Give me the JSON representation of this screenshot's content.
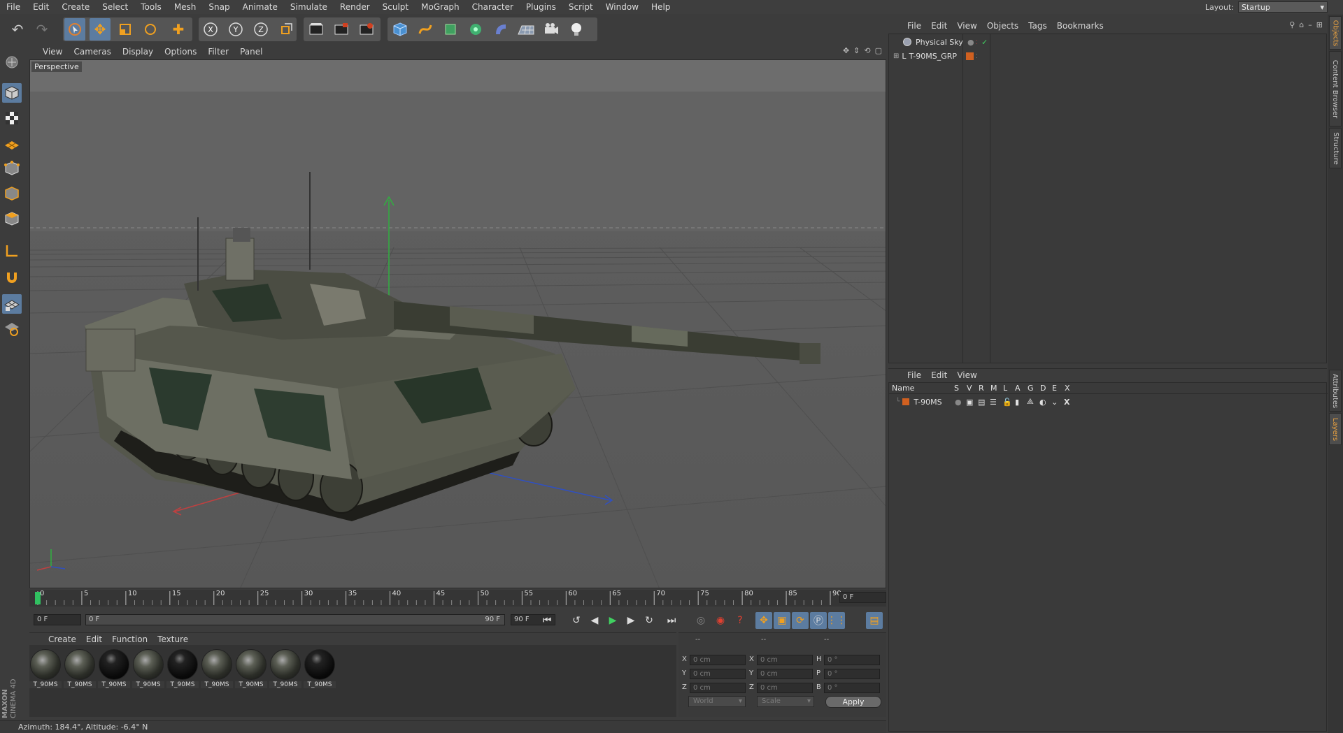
{
  "menubar": {
    "items": [
      "File",
      "Edit",
      "Create",
      "Select",
      "Tools",
      "Mesh",
      "Snap",
      "Animate",
      "Simulate",
      "Render",
      "Sculpt",
      "MoGraph",
      "Character",
      "Plugins",
      "Script",
      "Window",
      "Help"
    ],
    "layout_label": "Layout:",
    "layout_value": "Startup"
  },
  "toolbar": {
    "icons": [
      "undo-icon",
      "redo-icon",
      "live-selection-icon",
      "move-icon",
      "scale-icon",
      "rotate-icon",
      "recent-tool-icon",
      "x-axis-lock-icon",
      "y-axis-lock-icon",
      "z-axis-lock-icon",
      "coordinate-system-icon",
      "render-view-icon",
      "render-picture-viewer-icon",
      "render-settings-icon",
      "cube-primitive-icon",
      "spline-icon",
      "nurbs-icon",
      "array-icon",
      "deformer-icon",
      "floor-icon",
      "camera-icon",
      "light-icon"
    ],
    "axis_labels": [
      "X",
      "Y",
      "Z"
    ]
  },
  "viewport": {
    "menu": [
      "View",
      "Cameras",
      "Display",
      "Options",
      "Filter",
      "Panel"
    ],
    "label": "Perspective"
  },
  "timeline": {
    "ticks": [
      "0",
      "5",
      "10",
      "15",
      "20",
      "25",
      "30",
      "35",
      "40",
      "45",
      "50",
      "55",
      "60",
      "65",
      "70",
      "75",
      "80",
      "85",
      "90"
    ],
    "current_frame": "0 F",
    "start_frame": "0 F",
    "range_start": "0 F",
    "range_end": "90 F",
    "end_frame": "90 F"
  },
  "materials": {
    "menu": [
      "Create",
      "Edit",
      "Function",
      "Texture"
    ],
    "items": [
      {
        "name": "T_90MS",
        "dark": false
      },
      {
        "name": "T_90MS",
        "dark": false
      },
      {
        "name": "T_90MS",
        "dark": true
      },
      {
        "name": "T_90MS",
        "dark": false
      },
      {
        "name": "T_90MS",
        "dark": true
      },
      {
        "name": "T_90MS",
        "dark": false
      },
      {
        "name": "T_90MS",
        "dark": false
      },
      {
        "name": "T_90MS",
        "dark": false
      },
      {
        "name": "T_90MS",
        "dark": true
      }
    ]
  },
  "coordinates": {
    "headers": [
      "--",
      "--",
      "--"
    ],
    "rows": [
      {
        "a": "X",
        "av": "0 cm",
        "b": "X",
        "bv": "0 cm",
        "c": "H",
        "cv": "0 °"
      },
      {
        "a": "Y",
        "av": "0 cm",
        "b": "Y",
        "bv": "0 cm",
        "c": "P",
        "cv": "0 °"
      },
      {
        "a": "Z",
        "av": "0 cm",
        "b": "Z",
        "bv": "0 cm",
        "c": "B",
        "cv": "0 °"
      }
    ],
    "mode_world": "World",
    "mode_scale": "Scale",
    "apply_label": "Apply"
  },
  "status": {
    "text": "Azimuth: 184.4°, Altitude: -6.4°  N"
  },
  "object_manager": {
    "menu": [
      "File",
      "Edit",
      "View",
      "Objects",
      "Tags",
      "Bookmarks"
    ],
    "objects": [
      {
        "name": "Physical Sky",
        "color": "#9aa0b0"
      },
      {
        "name": "T-90MS_GRP",
        "color": "#d06020"
      }
    ]
  },
  "layer_manager": {
    "menu": [
      "File",
      "Edit",
      "View"
    ],
    "columns": [
      "Name",
      "S",
      "V",
      "R",
      "M",
      "L",
      "A",
      "G",
      "D",
      "E",
      "X"
    ],
    "layers": [
      {
        "name": "T-90MS",
        "color": "#d06020"
      }
    ]
  },
  "right_tabs": [
    "Objects",
    "Content Browser",
    "Structure",
    "Attributes",
    "Layers"
  ],
  "colors": {
    "accent": "#5c7ca0",
    "orange": "#d06020",
    "background": "#3c3c3c"
  }
}
